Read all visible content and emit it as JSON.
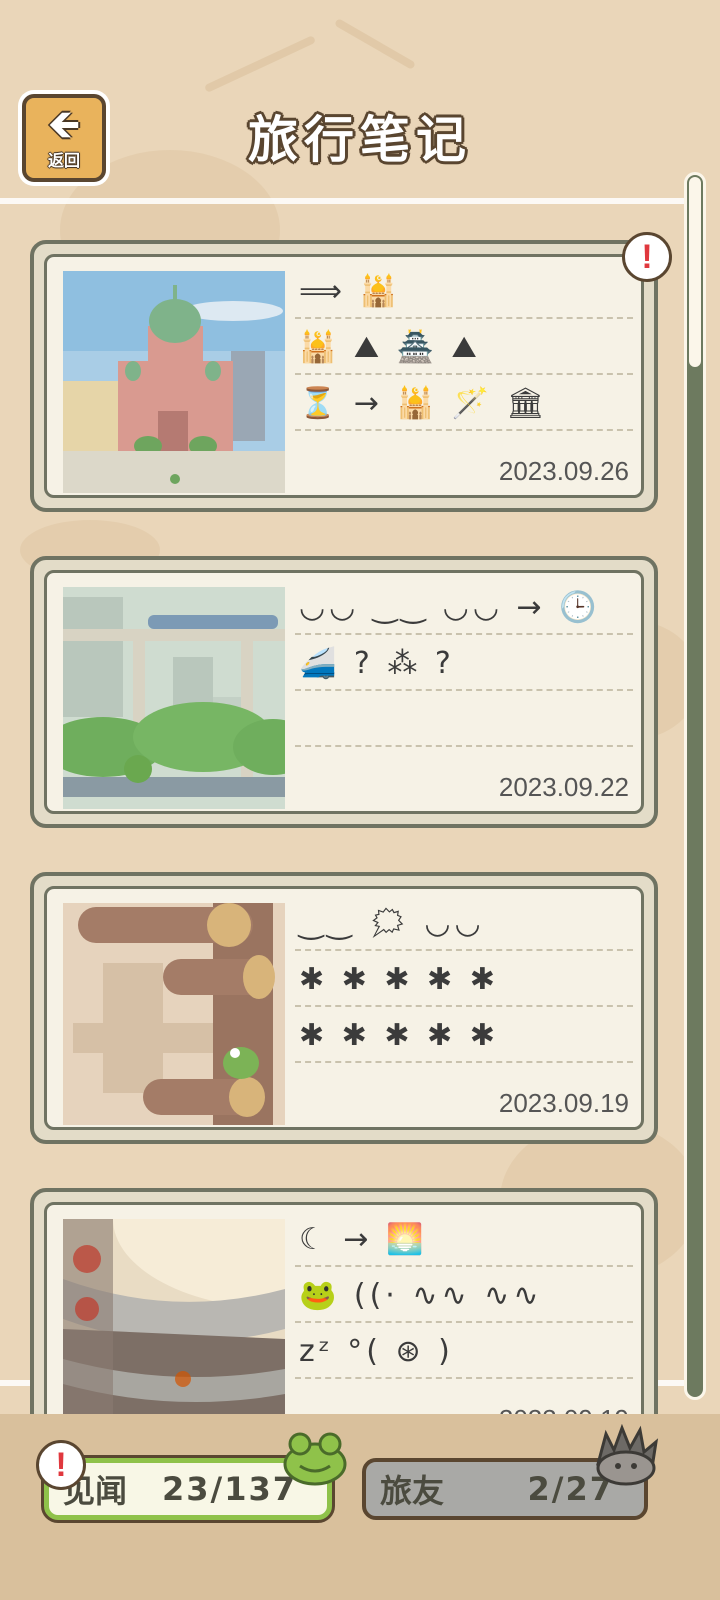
{
  "header": {
    "back_arrow_glyph": "🡸",
    "back_label": "返回",
    "title": "旅行笔记"
  },
  "entries": [
    {
      "glyph_lines": [
        "⟹ 🕌",
        "🕌 ⛰ 🏯 ⛰",
        "⏳ → 🕌 🪄 🏛"
      ],
      "date": "2023.09.26",
      "has_alert": true,
      "alert_glyph": "!",
      "photo": "cathedral"
    },
    {
      "glyph_lines": [
        "◡◡ ‿‿ ◡◡ → 🕒",
        "🚄 ? ⁂ ?",
        ""
      ],
      "date": "2023.09.22",
      "has_alert": false,
      "photo": "monorail"
    },
    {
      "glyph_lines": [
        "‿‿ 🗯 ◡◡",
        "✱ ✱ ✱ ✱ ✱",
        "✱ ✱ ✱ ✱ ✱"
      ],
      "date": "2023.09.19",
      "has_alert": false,
      "photo": "wooden-pole"
    },
    {
      "glyph_lines": [
        "☾ → 🌅",
        "🐸 ((· ∿∿ ∿∿",
        "zᶻ °( ⊛ )"
      ],
      "date": "2023.09.19",
      "has_alert": false,
      "photo": "roundhouse"
    }
  ],
  "stats": {
    "alert_glyph": "!",
    "seen_label": "见闻",
    "seen_value": "23/137",
    "friends_label": "旅友",
    "friends_value": "2/27"
  },
  "colors": {
    "background": "#ead6b9",
    "card_border": "#6f7362",
    "seen_accent": "#8fc24a",
    "alert_red": "#e0383e"
  }
}
